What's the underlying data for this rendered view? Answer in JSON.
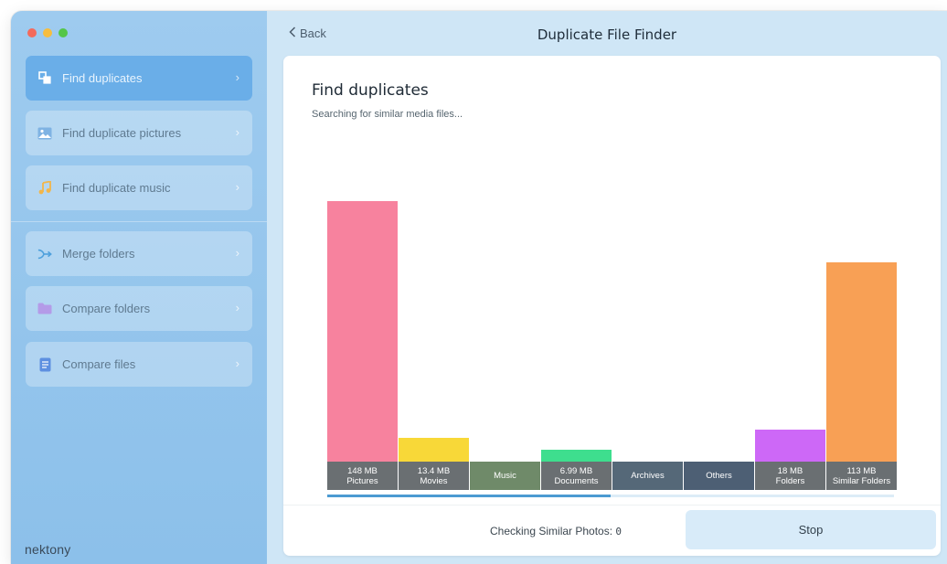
{
  "window": {
    "title": "Duplicate File Finder",
    "back_label": "Back"
  },
  "sidebar": {
    "items": [
      {
        "label": "Find duplicates",
        "icon": "find-duplicates-icon",
        "active": true
      },
      {
        "label": "Find duplicate pictures",
        "icon": "picture-icon",
        "active": false
      },
      {
        "label": "Find duplicate music",
        "icon": "music-note-icon",
        "active": false
      },
      {
        "label": "Merge folders",
        "icon": "merge-icon",
        "active": false
      },
      {
        "label": "Compare folders",
        "icon": "folder-icon",
        "active": false
      },
      {
        "label": "Compare files",
        "icon": "file-icon",
        "active": false
      }
    ],
    "logo": "nektony"
  },
  "main": {
    "heading": "Find duplicates",
    "subtitle": "Searching for similar media files...",
    "status_prefix": "Checking Similar Photos:",
    "status_count": "0",
    "stop_label": "Stop",
    "progress": 0.5
  },
  "chart_data": {
    "type": "bar",
    "unit": "MB",
    "categories": [
      {
        "name": "Pictures",
        "value_label": "148 MB",
        "value": 148,
        "color": "#f7829e"
      },
      {
        "name": "Movies",
        "value_label": "13.4 MB",
        "value": 13.4,
        "color": "#f8d838"
      },
      {
        "name": "Music",
        "value_label": "",
        "value": 0,
        "color": "#6f8a69"
      },
      {
        "name": "Documents",
        "value_label": "6.99 MB",
        "value": 6.99,
        "color": "#3ede8e"
      },
      {
        "name": "Archives",
        "value_label": "",
        "value": 0,
        "color": "#556878"
      },
      {
        "name": "Others",
        "value_label": "",
        "value": 0,
        "color": "#4d5f74"
      },
      {
        "name": "Folders",
        "value_label": "18 MB",
        "value": 18,
        "color": "#cd68f7"
      },
      {
        "name": "Similar Folders",
        "value_label": "113 MB",
        "value": 113,
        "color": "#f8a055"
      }
    ]
  }
}
